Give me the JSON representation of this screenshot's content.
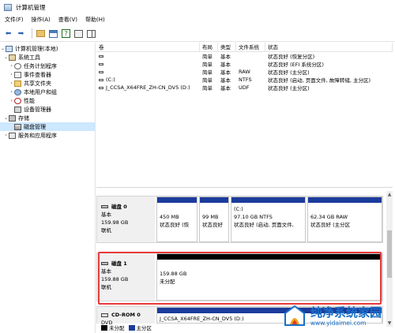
{
  "window": {
    "title": "计算机管理"
  },
  "menu": [
    "文件(F)",
    "操作(A)",
    "查看(V)",
    "帮助(H)"
  ],
  "toolbar": {
    "buttons": [
      "back-arrow-icon",
      "forward-arrow-icon",
      "up-folder-icon",
      "console-tree-icon",
      "help-icon",
      "properties-icon",
      "action-pane-icon"
    ]
  },
  "tree": {
    "root": "计算机管理(本地)",
    "items": [
      {
        "label": "系统工具",
        "icon": "tools-icon"
      },
      {
        "label": "任务计划程序",
        "icon": "clock-icon"
      },
      {
        "label": "事件查看器",
        "icon": "event-viewer-icon"
      },
      {
        "label": "共享文件夹",
        "icon": "folder-icon"
      },
      {
        "label": "本地用户和组",
        "icon": "users-icon"
      },
      {
        "label": "性能",
        "icon": "performance-icon"
      },
      {
        "label": "设备管理器",
        "icon": "device-manager-icon"
      },
      {
        "label": "存储",
        "icon": "storage-icon"
      },
      {
        "label": "磁盘管理",
        "icon": "disk-management-icon"
      },
      {
        "label": "服务和应用程序",
        "icon": "services-icon"
      }
    ]
  },
  "volume_table": {
    "headers": [
      "卷",
      "布局",
      "类型",
      "文件系统",
      "状态"
    ],
    "rows": [
      [
        "",
        "简单",
        "基本",
        "",
        "状态良好 (恢复分区)"
      ],
      [
        "",
        "简单",
        "基本",
        "",
        "状态良好 (EFI 系统分区)"
      ],
      [
        "",
        "简单",
        "基本",
        "RAW",
        "状态良好 (主分区)"
      ],
      [
        "(C:)",
        "简单",
        "基本",
        "NTFS",
        "状态良好 (启动, 页面文件, 故障转储, 主分区)"
      ],
      [
        "J_CCSA_X64FRE_ZH-CN_DV5 (D:)",
        "简单",
        "基本",
        "UDF",
        "状态良好 (主分区)"
      ]
    ]
  },
  "disks": [
    {
      "name": "磁盘 0",
      "type": "基本",
      "size": "159.98 GB",
      "status": "联机",
      "partitions": [
        {
          "title": "",
          "size": "450 MB",
          "status": "状态良好 (恢"
        },
        {
          "title": "",
          "size": "99 MB",
          "status": "状态良好"
        },
        {
          "title": "(C:)",
          "size": "97.10 GB NTFS",
          "status": "状态良好 (启动, 页面文件,"
        },
        {
          "title": "",
          "size": "62.34 GB RAW",
          "status": "状态良好 (主分区"
        }
      ]
    },
    {
      "name": "磁盘 1",
      "type": "基本",
      "size": "159.88 GB",
      "status": "联机",
      "partitions": [
        {
          "size": "159.88 GB",
          "status": "未分配"
        }
      ]
    },
    {
      "name": "CD-ROM 0",
      "type": "DVD",
      "partition_title": "J_CCSA_X64FRE_ZH-CN_DV5 (D:)"
    }
  ],
  "legend": [
    {
      "label": "未分配",
      "color": "#000000"
    },
    {
      "label": "主分区",
      "color": "#1b3b9c"
    }
  ],
  "watermark": {
    "text": "纯净系统家园",
    "url": "www.yidaimei.com"
  },
  "colors": {
    "partition_bar": "#1b3b9c",
    "highlight": "#e63a3a",
    "selection": "#cde8ff"
  }
}
